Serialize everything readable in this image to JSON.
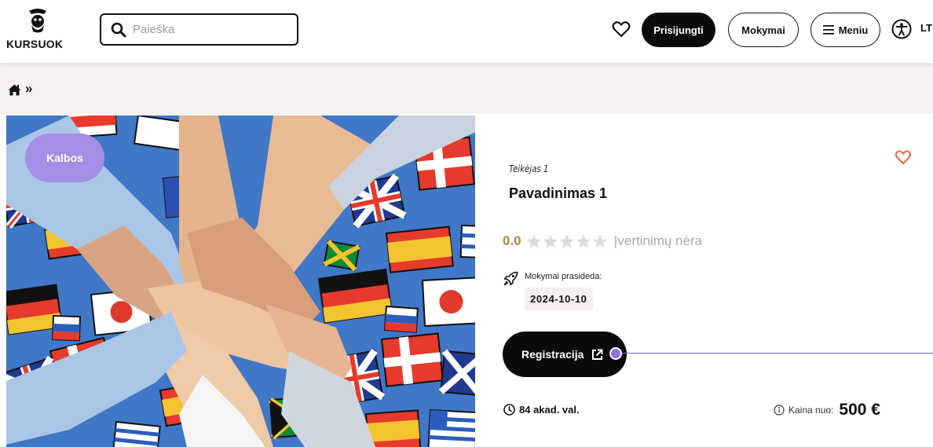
{
  "header": {
    "logo_text": "KURSUOK",
    "search_placeholder": "Paieška",
    "login_label": "Prisijungti",
    "courses_label": "Mokymai",
    "menu_label": "Meniu",
    "lang_label": "LT",
    "icons": [
      "logo-icon",
      "search-icon",
      "heart-icon",
      "menu-icon",
      "accessibility-icon"
    ]
  },
  "breadcrumb": {
    "separator": "»",
    "icons": [
      "home-icon"
    ]
  },
  "course": {
    "category_tag": "Kalbos",
    "provider": "Teikėjas 1",
    "title": "Pavadinimas 1",
    "rating_value": "0.0",
    "rating_stars": 0,
    "rating_stars_max": 5,
    "rating_text": "Įvertinimų nėra",
    "start_label": "Mokymai prasideda:",
    "start_date": "2024-10-10",
    "register_label": "Registracija",
    "hours_label": "84 akad. val.",
    "price_label": "Kaina nuo:",
    "price_value": "500 €"
  },
  "colors": {
    "accent": "#a58ee6",
    "link_line": "#8069d8",
    "rating_value": "#a88a3d",
    "favorite": "#e06a45",
    "breadcrumb_bg": "#f6f2f2",
    "button_dark": "#0b0b0b"
  }
}
